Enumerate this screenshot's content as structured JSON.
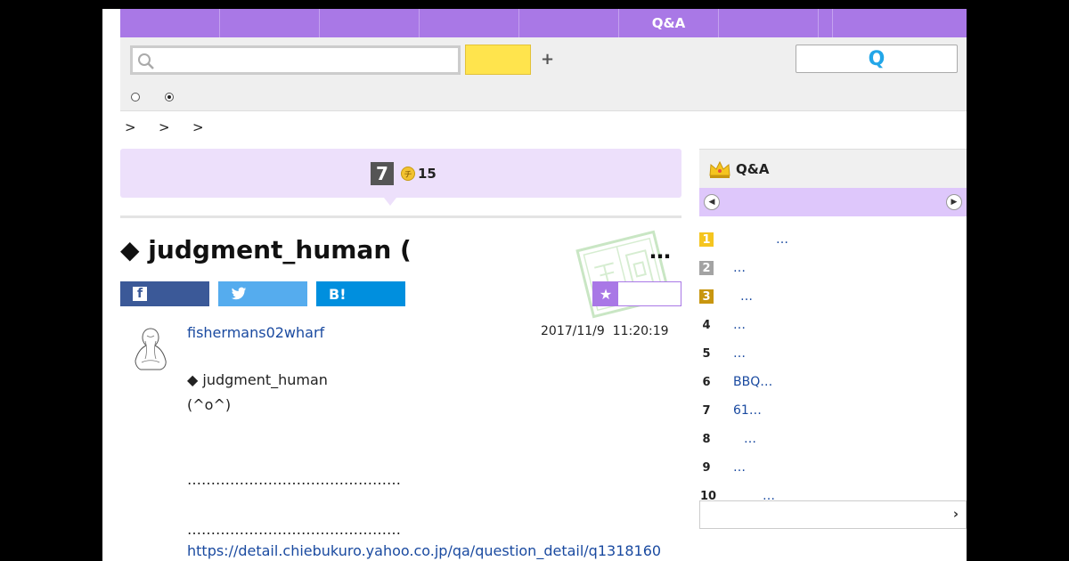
{
  "nav": {
    "items": [
      "",
      "",
      "",
      "",
      "",
      "Q&A",
      "",
      "",
      ""
    ]
  },
  "search": {
    "placeholder": "",
    "yellow_label": "",
    "plus_label": "+",
    "q_label": "Q"
  },
  "breadcrumb": [
    ">",
    ">",
    ">"
  ],
  "banner": {
    "badge": "7",
    "coin_icon": "チ",
    "coin_count": "15"
  },
  "question": {
    "title": "◆ judgment_human (",
    "title_more": "…",
    "share": {
      "facebook": "f",
      "twitter": "",
      "hatena": "B!"
    },
    "favorite_star": "★"
  },
  "post": {
    "username": "fishermans02wharf",
    "date": "2017/11/9  11:20:19",
    "lines": [
      "◆ judgment_human",
      "(^o^)",
      "………………………………………",
      "………………………………………"
    ],
    "link": "https://detail.chiebukuro.yahoo.co.jp/qa/question_detail/q1318160"
  },
  "sidebar": {
    "title": "Q&A",
    "ranking": [
      {
        "rank": "1",
        "text": "…"
      },
      {
        "rank": "2",
        "text": "…"
      },
      {
        "rank": "3",
        "text": "…"
      },
      {
        "rank": "4",
        "text": "…"
      },
      {
        "rank": "5",
        "text": "…"
      },
      {
        "rank": "6",
        "text": "BBQ…"
      },
      {
        "rank": "7",
        "text": "61…"
      },
      {
        "rank": "8",
        "text": "…"
      },
      {
        "rank": "9",
        "text": "…"
      },
      {
        "rank": "10",
        "text": "…"
      }
    ],
    "more_arrow": "›"
  },
  "colors": {
    "accent": "#a978e6",
    "banner": "#ede0fb",
    "link": "#1a4aa0"
  }
}
